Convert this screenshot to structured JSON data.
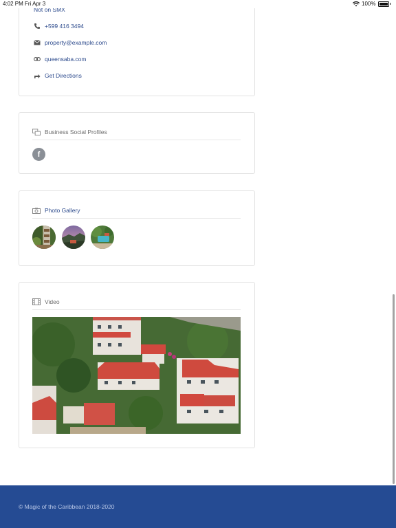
{
  "status_bar": {
    "time": "4:02 PM",
    "date": "Fri Apr 3",
    "battery": "100%"
  },
  "contact": {
    "partial_text": "Not on SMX",
    "phone": "+599 416 3494",
    "email": "property@example.com",
    "website": "queensaba.com",
    "directions": "Get Directions"
  },
  "social": {
    "title": "Business Social Profiles",
    "facebook_glyph": "f"
  },
  "gallery": {
    "title": "Photo Gallery",
    "photos": [
      "garden",
      "sunset",
      "pool"
    ]
  },
  "video": {
    "title": "Video"
  },
  "footer": {
    "copyright": "© Magic of the Caribbean 2018-2020"
  },
  "colors": {
    "link": "#2c4a8c",
    "footer_bg": "#254b93"
  }
}
